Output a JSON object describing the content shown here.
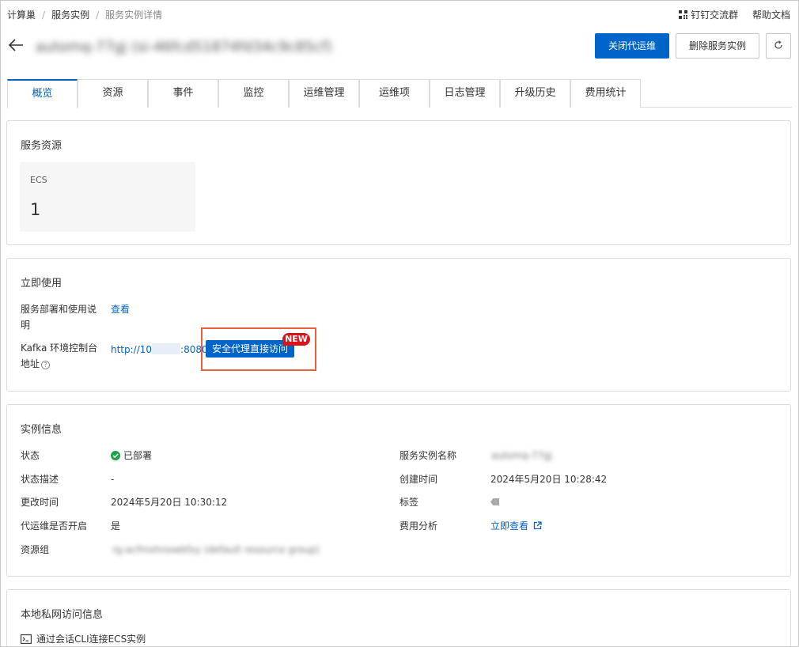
{
  "breadcrumb": {
    "items": [
      "计算巢",
      "服务实例"
    ],
    "current": "服务实例详情",
    "separator": "/"
  },
  "top_links": {
    "dingtalk": "钉钉交流群",
    "help": "帮助文档"
  },
  "header": {
    "title": "automq-77gj (si-46fcd51874fd34c9c85cf)",
    "close_ops_label": "关闭代运维",
    "delete_label": "删除服务实例"
  },
  "tabs": [
    "概览",
    "资源",
    "事件",
    "监控",
    "运维管理",
    "运维项",
    "日志管理",
    "升级历史",
    "费用统计"
  ],
  "active_tab": "概览",
  "service_resources": {
    "title": "服务资源",
    "ecs_label": "ECS",
    "ecs_count": "1"
  },
  "use_now": {
    "title": "立即使用",
    "deploy_doc_label": "服务部署和使用说明",
    "deploy_doc_link": "查看",
    "kafka_label": "Kafka 环境控制台地址",
    "kafka_url_prefix": "http://10",
    "kafka_url_suffix": ":8080",
    "proxy_button": "安全代理直接访问",
    "new_badge": "NEW"
  },
  "instance_info": {
    "title": "实例信息",
    "status_label": "状态",
    "status_value": "已部署",
    "status_desc_label": "状态描述",
    "status_desc_value": "-",
    "modified_label": "更改时间",
    "modified_value": "2024年5月20日 10:30:12",
    "ops_enabled_label": "代运维是否开启",
    "ops_enabled_value": "是",
    "resource_group_label": "资源组",
    "resource_group_value": "rg-acfmxhnowbfxy (default resource group)",
    "instance_name_label": "服务实例名称",
    "instance_name_value": "automq-77gj",
    "created_label": "创建时间",
    "created_value": "2024年5月20日 10:28:42",
    "tags_label": "标签",
    "cost_label": "费用分析",
    "cost_link": "立即查看"
  },
  "private_network": {
    "title": "本地私网访问信息",
    "cli_link": "通过会话CLI连接ECS实例"
  },
  "colors": {
    "primary": "#0064c8",
    "success": "#1fa34a",
    "badge_red": "#d9141b",
    "highlight": "#e8603c"
  }
}
